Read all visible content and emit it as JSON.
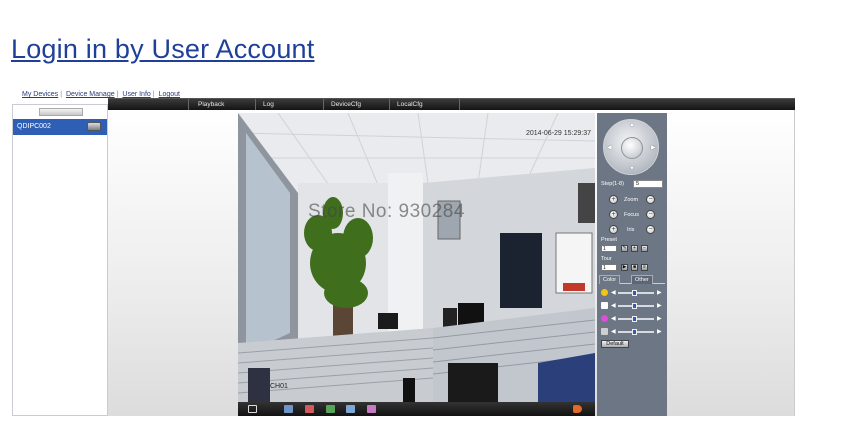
{
  "page": {
    "title": "Login in by User Account"
  },
  "nav": {
    "items": [
      "My Devices",
      "Device Manage",
      "User Info",
      "Logout"
    ]
  },
  "devices": [
    {
      "label": "QDIPC002"
    }
  ],
  "menu": {
    "items": [
      "Playback",
      "Log",
      "DeviceCfg",
      "LocalCfg"
    ]
  },
  "video": {
    "watermark": "Store No: 930284",
    "timestamp": "2014-06-29 15:29:37",
    "channel": "CH01"
  },
  "ptz": {
    "step_label": "Step(1-8)",
    "step_value": "5",
    "zoom_label": "Zoom",
    "focus_label": "Focus",
    "iris_label": "Iris",
    "preset_label": "Preset",
    "preset_value": "1",
    "tour_label": "Tour",
    "tour_value": "1",
    "tab_color": "Color",
    "tab_other": "Other",
    "default_button": "Default"
  },
  "colors": {
    "accent": "#2f5fb5",
    "title": "#1f3f99",
    "menu_bg": "#1a1a1a",
    "ptz_bg": "#6c7684"
  },
  "icons": [
    "camera-icon",
    "fullscreen-icon",
    "record-icon",
    "snapshot-icon",
    "talk-icon",
    "volume-icon",
    "brightness-icon",
    "contrast-icon",
    "saturation-icon",
    "hue-icon"
  ]
}
